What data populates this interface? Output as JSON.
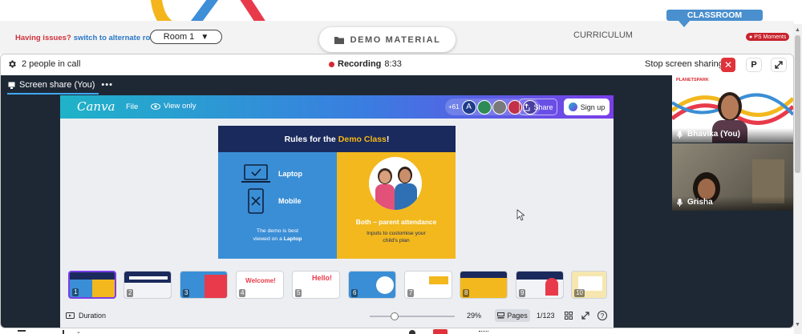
{
  "header": {
    "help_text": "Having issues?",
    "switch_link": "switch to alternate room",
    "room_select": "Room 1",
    "demo_button": "DEMO MATERIAL",
    "curriculum_tab": "CURRICULUM",
    "classroom_tab": "CLASSROOM",
    "ps_moments": "PS Moments"
  },
  "callbar": {
    "people": "2 people in call",
    "recording_label": "Recording",
    "recording_time": "8:33",
    "stop_sharing": "Stop screen sharing",
    "p_button": "P"
  },
  "share_tab": {
    "label": "Screen share (You)"
  },
  "canva": {
    "logo": "Canva",
    "file": "File",
    "view_only": "View only",
    "collab_count": "+61",
    "avatar_letter": "A",
    "share": "Share",
    "signup": "Sign up",
    "duration": "Duration",
    "zoom": "29%",
    "pages": "Pages",
    "page_count": "1/123"
  },
  "slide": {
    "title_prefix": "Rules for the",
    "title_highlight": "Demo Class",
    "title_suffix": "!",
    "laptop": "Laptop",
    "mobile": "Mobile",
    "note_line1": "The demo is best",
    "note_line2_prefix": "viewed on a",
    "note_line2_bold": "Laptop",
    "parent_title": "Both – parent attendance",
    "parent_sub1": "Inputs to customise your",
    "parent_sub2": "child's plan"
  },
  "thumbnails": [
    "1",
    "2",
    "3",
    "4",
    "5",
    "6",
    "7",
    "8",
    "9",
    "10"
  ],
  "thumb_texts": {
    "welcome": "Welcome!",
    "hello": "Hello!"
  },
  "participants": [
    {
      "name": "Bhavika (You)"
    },
    {
      "name": "Grisha"
    }
  ],
  "video_logo": "PLANETSPARK",
  "colors": {
    "canva_gradient_start": "#1fb3c8",
    "canva_gradient_end": "#7a3ee8",
    "slide_navy": "#1b2a5c",
    "slide_blue": "#3a8ed6",
    "slide_yellow": "#f2b81d",
    "stop_red": "#e0323a",
    "classroom_blue": "#4a8fce"
  }
}
